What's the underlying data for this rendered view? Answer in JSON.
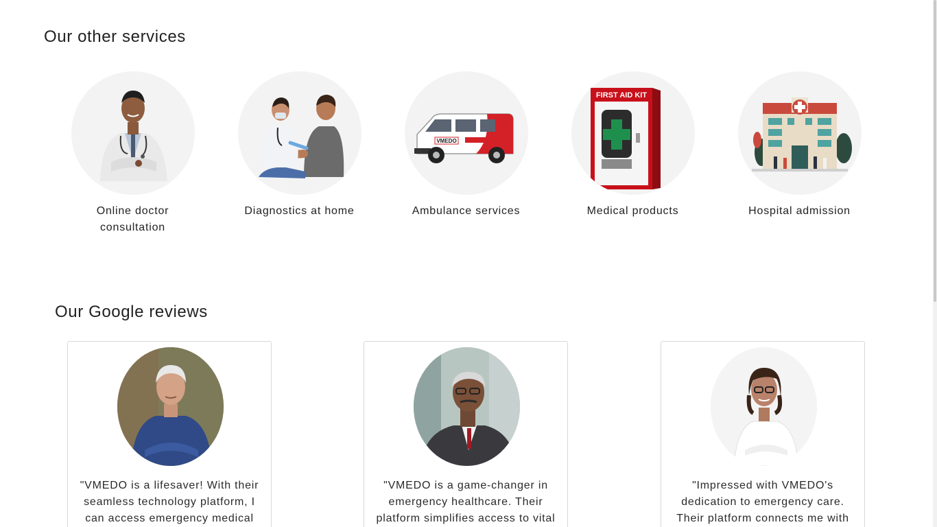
{
  "services": {
    "title": "Our other services",
    "items": [
      {
        "label": "Online doctor consultation",
        "icon": "doctor-icon"
      },
      {
        "label": "Diagnostics at home",
        "icon": "diagnostics-icon"
      },
      {
        "label": "Ambulance services",
        "icon": "ambulance-icon"
      },
      {
        "label": "Medical products",
        "icon": "first-aid-kit-icon"
      },
      {
        "label": "Hospital admission",
        "icon": "hospital-icon"
      }
    ],
    "ambulance_brand": "VMEDO",
    "first_aid_text": "FIRST AID KIT"
  },
  "reviews": {
    "title": "Our Google reviews",
    "items": [
      {
        "text": "\"VMEDO is a lifesaver! With their seamless technology platform, I can access emergency medical"
      },
      {
        "text": "\"VMEDO is a game-changer in emergency healthcare. Their platform simplifies access to vital"
      },
      {
        "text": "\"Impressed with VMEDO's dedication to emergency care. Their platform connects me with"
      }
    ]
  },
  "colors": {
    "circle_bg": "#f3f3f3",
    "card_border": "#d8d8d8",
    "ambulance_red": "#d42027",
    "kit_red": "#c8101a",
    "hospital_roof": "#c94a3c"
  }
}
